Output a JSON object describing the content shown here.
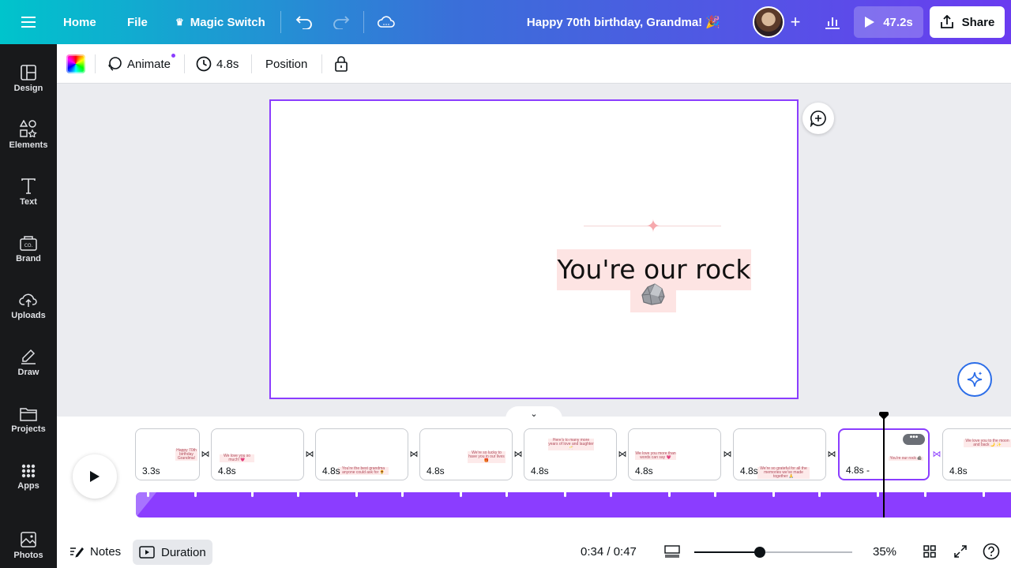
{
  "topbar": {
    "menu_icon": "hamburger-icon",
    "home_label": "Home",
    "file_label": "File",
    "magic_switch_label": "Magic Switch",
    "doc_title": "Happy 70th birthday, Grandma! 🎉",
    "play_duration": "47.2s",
    "share_label": "Share"
  },
  "sidebar": {
    "items": [
      {
        "label": "Design",
        "icon": "layout-icon"
      },
      {
        "label": "Elements",
        "icon": "shapes-icon"
      },
      {
        "label": "Text",
        "icon": "text-icon"
      },
      {
        "label": "Brand",
        "icon": "brand-icon"
      },
      {
        "label": "Uploads",
        "icon": "cloud-upload-icon"
      },
      {
        "label": "Draw",
        "icon": "pen-icon"
      },
      {
        "label": "Projects",
        "icon": "folder-icon"
      },
      {
        "label": "Apps",
        "icon": "apps-grid-icon"
      },
      {
        "label": "Photos",
        "icon": "image-icon"
      }
    ]
  },
  "toolbar": {
    "animate_label": "Animate",
    "duration_label": "4.8s",
    "position_label": "Position"
  },
  "canvas": {
    "main_text": "You're our rock",
    "accent_color": "#8b3dff",
    "highlight_color": "#fde4e3"
  },
  "timeline": {
    "scenes": [
      {
        "duration": "3.3s",
        "thumb": "Happy 70th birthday Grandma!"
      },
      {
        "duration": "4.8s",
        "thumb": "We love you so much! 💗"
      },
      {
        "duration": "4.8s",
        "thumb": "You're the best grandma anyone could ask for 🌻"
      },
      {
        "duration": "4.8s",
        "thumb": "We're so lucky to have you in our lives 🎁"
      },
      {
        "duration": "4.8s",
        "thumb": "Here's to many more years of love and laughter 🥂"
      },
      {
        "duration": "4.8s",
        "thumb": "We love you more than words can say 💗"
      },
      {
        "duration": "4.8s",
        "thumb": "We're so grateful for all the memories we've made together 🙏"
      },
      {
        "duration": "4.8s -",
        "thumb": "You're our rock 🪨"
      },
      {
        "duration": "4.8s",
        "thumb": "We love you to the moon and back 🌙 ✨"
      }
    ],
    "active_scene_index": 7
  },
  "bottombar": {
    "notes_label": "Notes",
    "duration_label": "Duration",
    "time_display": "0:34 / 0:47",
    "zoom_percent": 35,
    "zoom_label": "35%"
  }
}
